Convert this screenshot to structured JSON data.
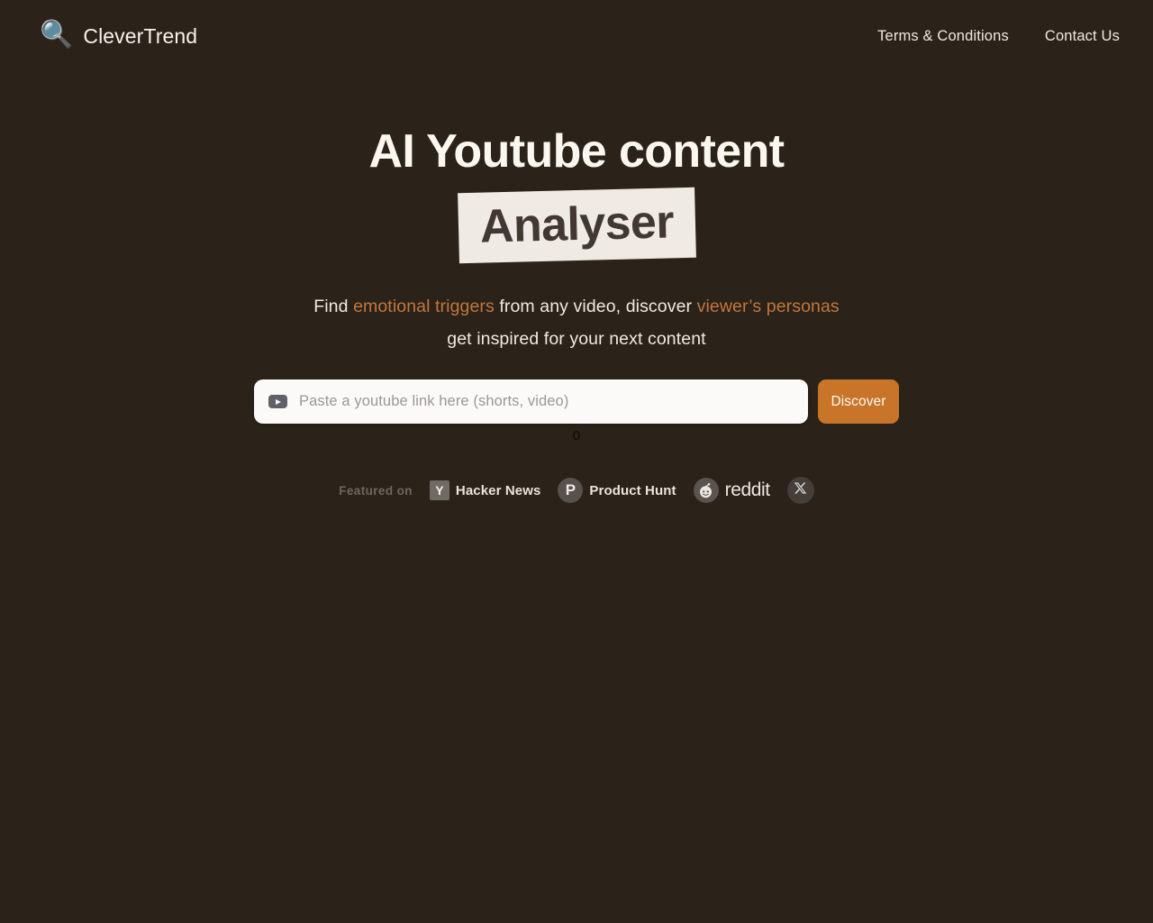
{
  "colors": {
    "background": "#2b2219",
    "accent_orange": "#c2773b",
    "button_orange": "#c8752a",
    "highlight_cream": "#efeae3",
    "text_light": "#f5efe8",
    "muted": "#6e6761"
  },
  "header": {
    "logo_icon": "magnifier-icon",
    "brand_name": "CleverTrend",
    "nav": [
      {
        "label": "Terms & Conditions"
      },
      {
        "label": "Contact Us"
      }
    ]
  },
  "hero": {
    "headline_line1": "AI Youtube content",
    "headline_highlight": "Analyser",
    "subtitle": {
      "part1": "Find ",
      "accent1": "emotional triggers",
      "part2": " from any video, discover ",
      "accent2": "viewer’s personas",
      "line2": "get inspired for your next content"
    }
  },
  "search": {
    "icon": "youtube-icon",
    "placeholder": "Paste a youtube link here (shorts, video)",
    "value": "",
    "button_label": "Discover",
    "counter": "0"
  },
  "featured": {
    "label": "Featured on",
    "items": [
      {
        "mark": "Y",
        "label": "Hacker News",
        "icon": "hacker-news-icon"
      },
      {
        "mark": "P",
        "label": "Product Hunt",
        "icon": "product-hunt-icon"
      },
      {
        "mark": "",
        "label": "reddit",
        "icon": "reddit-icon"
      },
      {
        "mark": "",
        "label": "",
        "icon": "x-twitter-icon"
      }
    ]
  }
}
